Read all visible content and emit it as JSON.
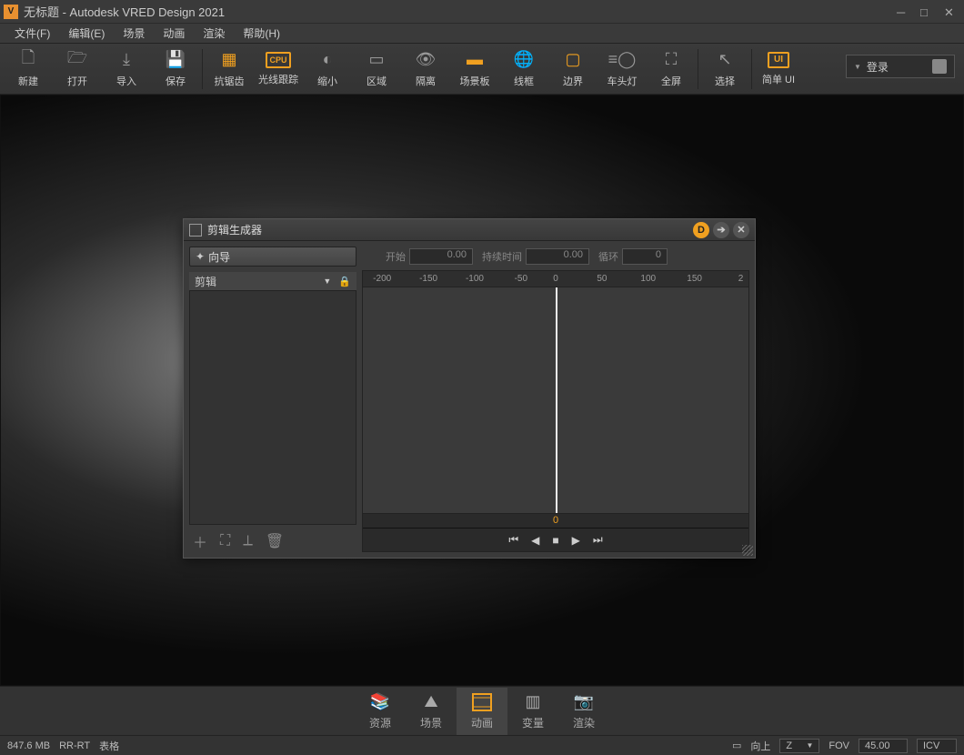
{
  "titlebar": {
    "title": "无标题 - Autodesk VRED Design 2021"
  },
  "menubar": {
    "items": [
      {
        "label": "文件(F)"
      },
      {
        "label": "编辑(E)"
      },
      {
        "label": "场景"
      },
      {
        "label": "动画"
      },
      {
        "label": "渲染"
      },
      {
        "label": "帮助(H)"
      }
    ]
  },
  "toolbar": {
    "new": "新建",
    "open": "打开",
    "import": "导入",
    "save": "保存",
    "antialias": "抗锯齿",
    "raytrace": "光线跟踪",
    "reduce": "缩小",
    "region": "区域",
    "isolate": "隔离",
    "sceneboard": "场景板",
    "wireframe": "线框",
    "boundary": "边界",
    "headlight": "车头灯",
    "fullscreen": "全屏",
    "select": "选择",
    "simpleui": "简单 UI",
    "login": "登录"
  },
  "panel": {
    "title": "剪辑生成器",
    "wizard": "向导",
    "clip_label": "剪辑",
    "start_label": "开始",
    "start_val": "0.00",
    "duration_label": "持续时间",
    "duration_val": "0.00",
    "loop_label": "循环",
    "loop_val": "0",
    "ruler": [
      "-200",
      "-150",
      "-100",
      "-50",
      "0",
      "50",
      "100",
      "150",
      "2"
    ],
    "pos": "0"
  },
  "bottom_tabs": {
    "resource": "资源",
    "scene": "场景",
    "animation": "动画",
    "variable": "变量",
    "render": "渲染"
  },
  "statusbar": {
    "memory": "847.6 MB",
    "rrrt": "RR-RT",
    "table": "表格",
    "up_label": "向上",
    "axis": "Z",
    "fov_label": "FOV",
    "fov_val": "45.00",
    "icv": "ICV"
  }
}
